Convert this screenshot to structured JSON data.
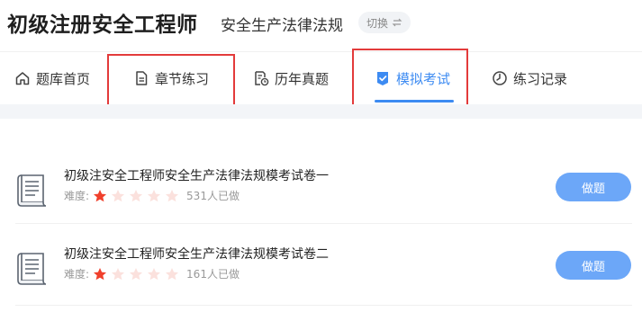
{
  "header": {
    "title": "初级注册安全工程师",
    "subject": "安全生产法律法规",
    "switch_label": "切换",
    "switch_icon": "swap-icon"
  },
  "nav": {
    "items": [
      {
        "label": "题库首页",
        "icon": "home-icon",
        "active": false
      },
      {
        "label": "章节练习",
        "icon": "document-icon",
        "active": false
      },
      {
        "label": "历年真题",
        "icon": "history-paper-icon",
        "active": false
      },
      {
        "label": "模拟考试",
        "icon": "checked-shield-icon",
        "active": true
      },
      {
        "label": "练习记录",
        "icon": "clock-icon",
        "active": false
      }
    ],
    "active_color": "#3d8bf2"
  },
  "exams": [
    {
      "title": "初级注安全工程师安全生产法律法规模考试卷一",
      "difficulty_label": "难度:",
      "difficulty_stars": 1,
      "difficulty_max": 5,
      "participants": "531人已做",
      "action_label": "做题"
    },
    {
      "title": "初级注安全工程师安全生产法律法规模考试卷二",
      "difficulty_label": "难度:",
      "difficulty_stars": 1,
      "difficulty_max": 5,
      "participants": "161人已做",
      "action_label": "做题"
    }
  ],
  "colors": {
    "accent": "#3d8bf2",
    "button": "#6ca7f8",
    "star_on": "#f0402c",
    "star_off": "#fbe1dd",
    "highlight_box": "#e33b3b"
  }
}
